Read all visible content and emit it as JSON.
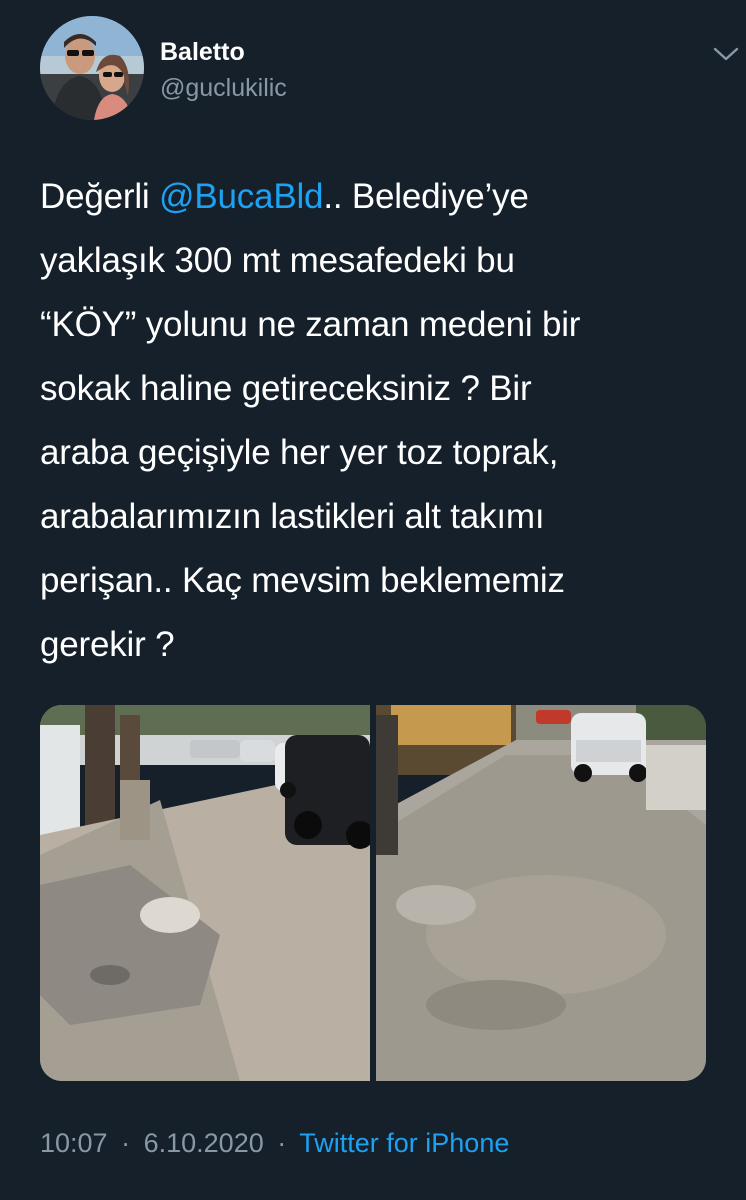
{
  "author": {
    "name": "Baletto",
    "handle": "@guclukilic",
    "avatar_icon": "profile-photo"
  },
  "menu": {
    "icon": "chevron-down-icon"
  },
  "tweet": {
    "lines": [
      {
        "parts": [
          {
            "text": "Değerli "
          },
          {
            "text": "@BucaBld",
            "mention": true
          },
          {
            "text": ".. Belediye’ye"
          }
        ]
      },
      {
        "parts": [
          {
            "text": "yaklaşık 300 mt mesafedeki bu"
          }
        ]
      },
      {
        "parts": [
          {
            "text": "“KÖY” yolunu ne zaman medeni bir"
          }
        ]
      },
      {
        "parts": [
          {
            "text": "sokak haline getireceksiniz ? Bir"
          }
        ]
      },
      {
        "parts": [
          {
            "text": "araba geçişiyle her yer toz toprak,"
          }
        ]
      },
      {
        "parts": [
          {
            "text": "arabalarımızın lastikleri alt takımı"
          }
        ]
      },
      {
        "parts": [
          {
            "text": "perişan.. Kaç mevsim beklememiz"
          }
        ]
      },
      {
        "parts": [
          {
            "text": "gerekir ?"
          }
        ]
      }
    ]
  },
  "media": {
    "photos": [
      {
        "name": "street-photo-1"
      },
      {
        "name": "street-photo-2"
      }
    ]
  },
  "meta": {
    "time": "10:07",
    "separator": "·",
    "date": "6.10.2020",
    "source": "Twitter for iPhone"
  },
  "colors": {
    "background": "#15202b",
    "text": "#ffffff",
    "secondary": "#8899a6",
    "accent": "#1da1f2"
  }
}
